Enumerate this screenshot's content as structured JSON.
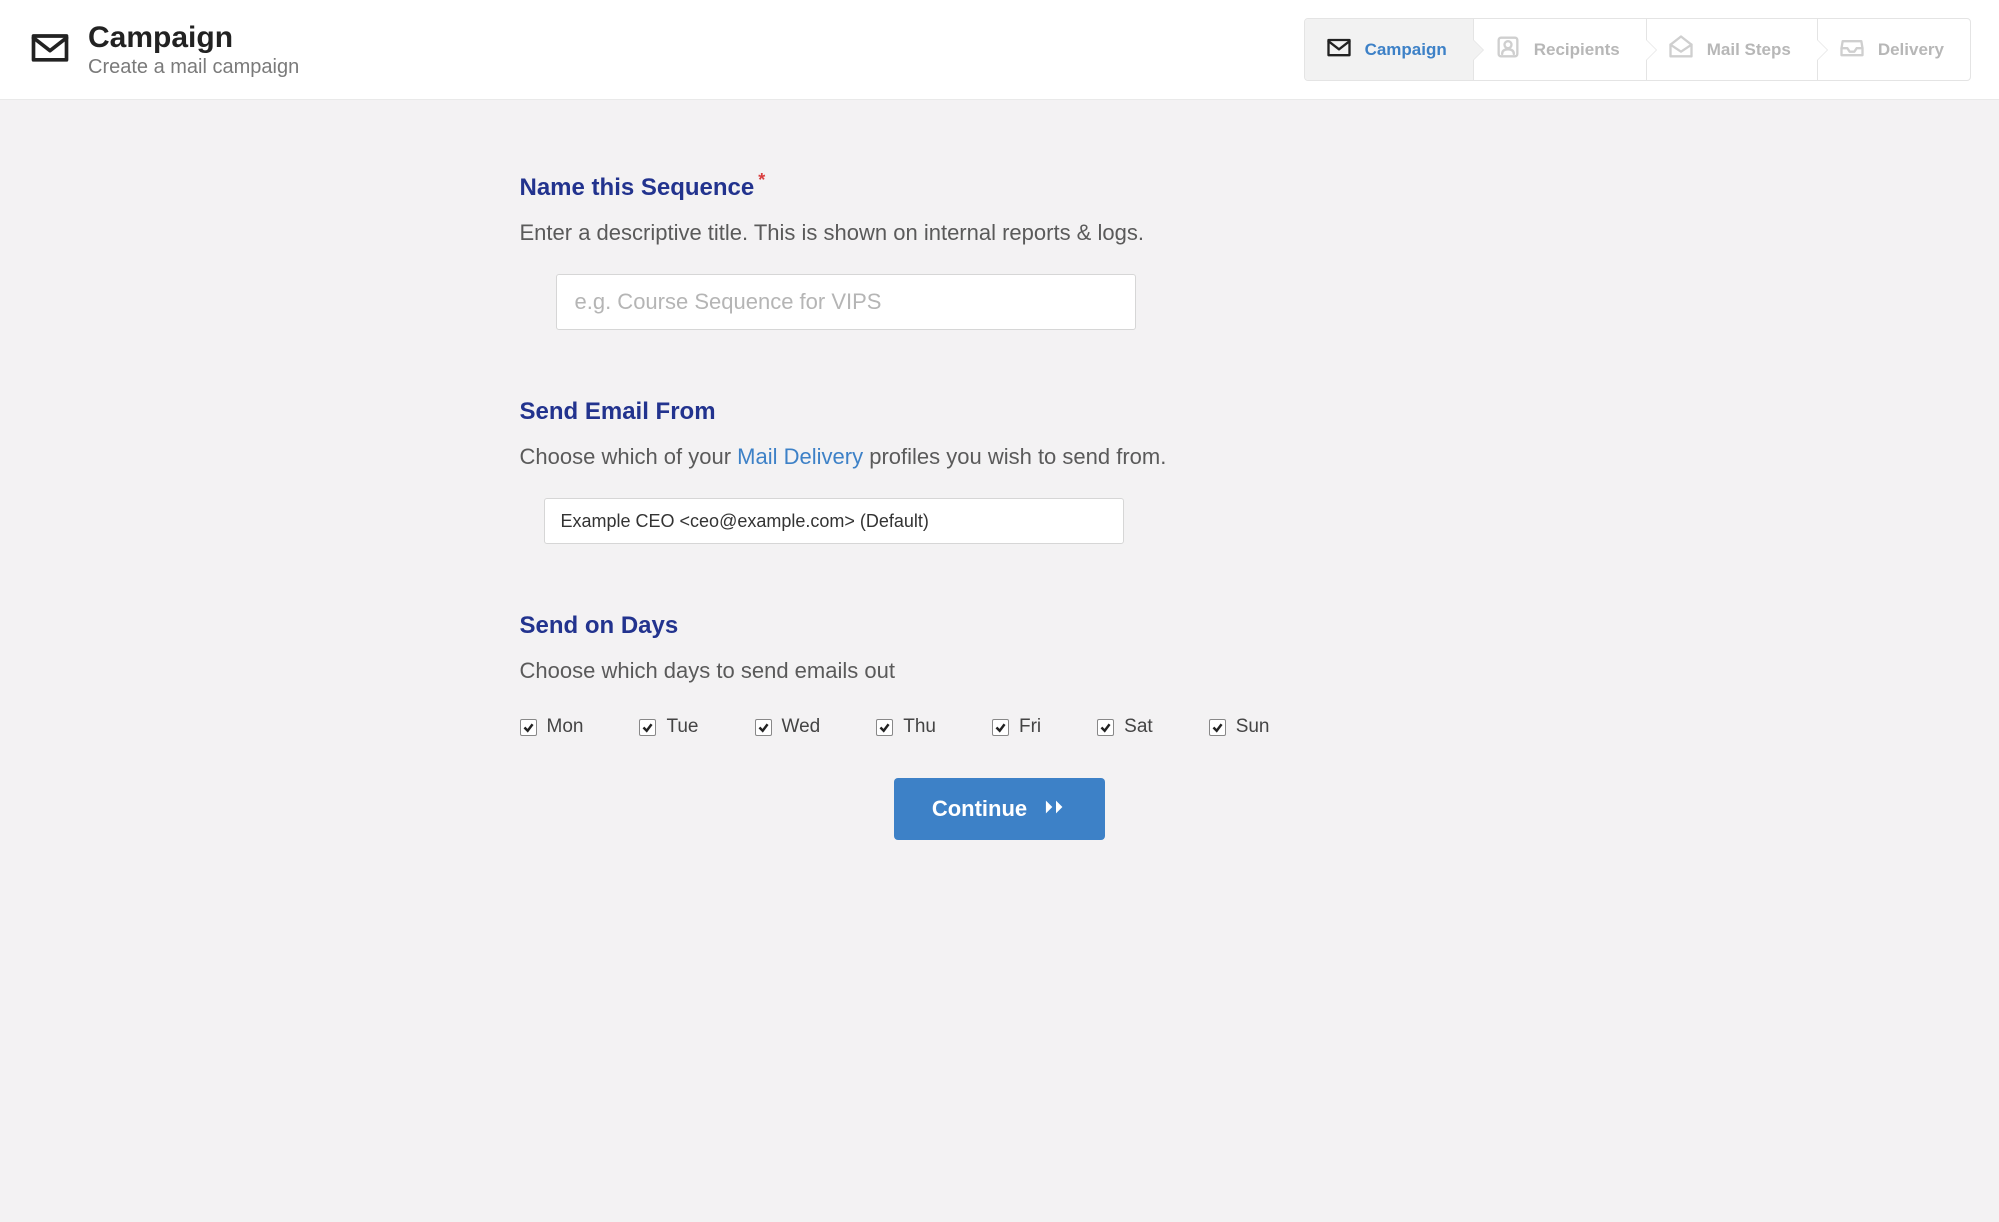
{
  "header": {
    "title": "Campaign",
    "subtitle": "Create a mail campaign"
  },
  "wizard": {
    "steps": [
      {
        "label": "Campaign",
        "icon": "envelope-icon",
        "active": true
      },
      {
        "label": "Recipients",
        "icon": "person-icon",
        "active": false
      },
      {
        "label": "Mail Steps",
        "icon": "envelope-open-icon",
        "active": false
      },
      {
        "label": "Delivery",
        "icon": "inbox-icon",
        "active": false
      }
    ]
  },
  "form": {
    "name_section": {
      "title": "Name this Sequence",
      "required": true,
      "description": "Enter a descriptive title. This is shown on internal reports & logs.",
      "placeholder": "e.g. Course Sequence for VIPS",
      "value": ""
    },
    "from_section": {
      "title": "Send Email From",
      "description_pre": "Choose which of your ",
      "description_link": "Mail Delivery",
      "description_post": " profiles you wish to send from.",
      "selected": "Example CEO <ceo@example.com> (Default)"
    },
    "days_section": {
      "title": "Send on Days",
      "description": "Choose which days to send emails out",
      "days": [
        {
          "label": "Mon",
          "checked": true
        },
        {
          "label": "Tue",
          "checked": true
        },
        {
          "label": "Wed",
          "checked": true
        },
        {
          "label": "Thu",
          "checked": true
        },
        {
          "label": "Fri",
          "checked": true
        },
        {
          "label": "Sat",
          "checked": true
        },
        {
          "label": "Sun",
          "checked": true
        }
      ]
    },
    "continue_label": "Continue"
  }
}
